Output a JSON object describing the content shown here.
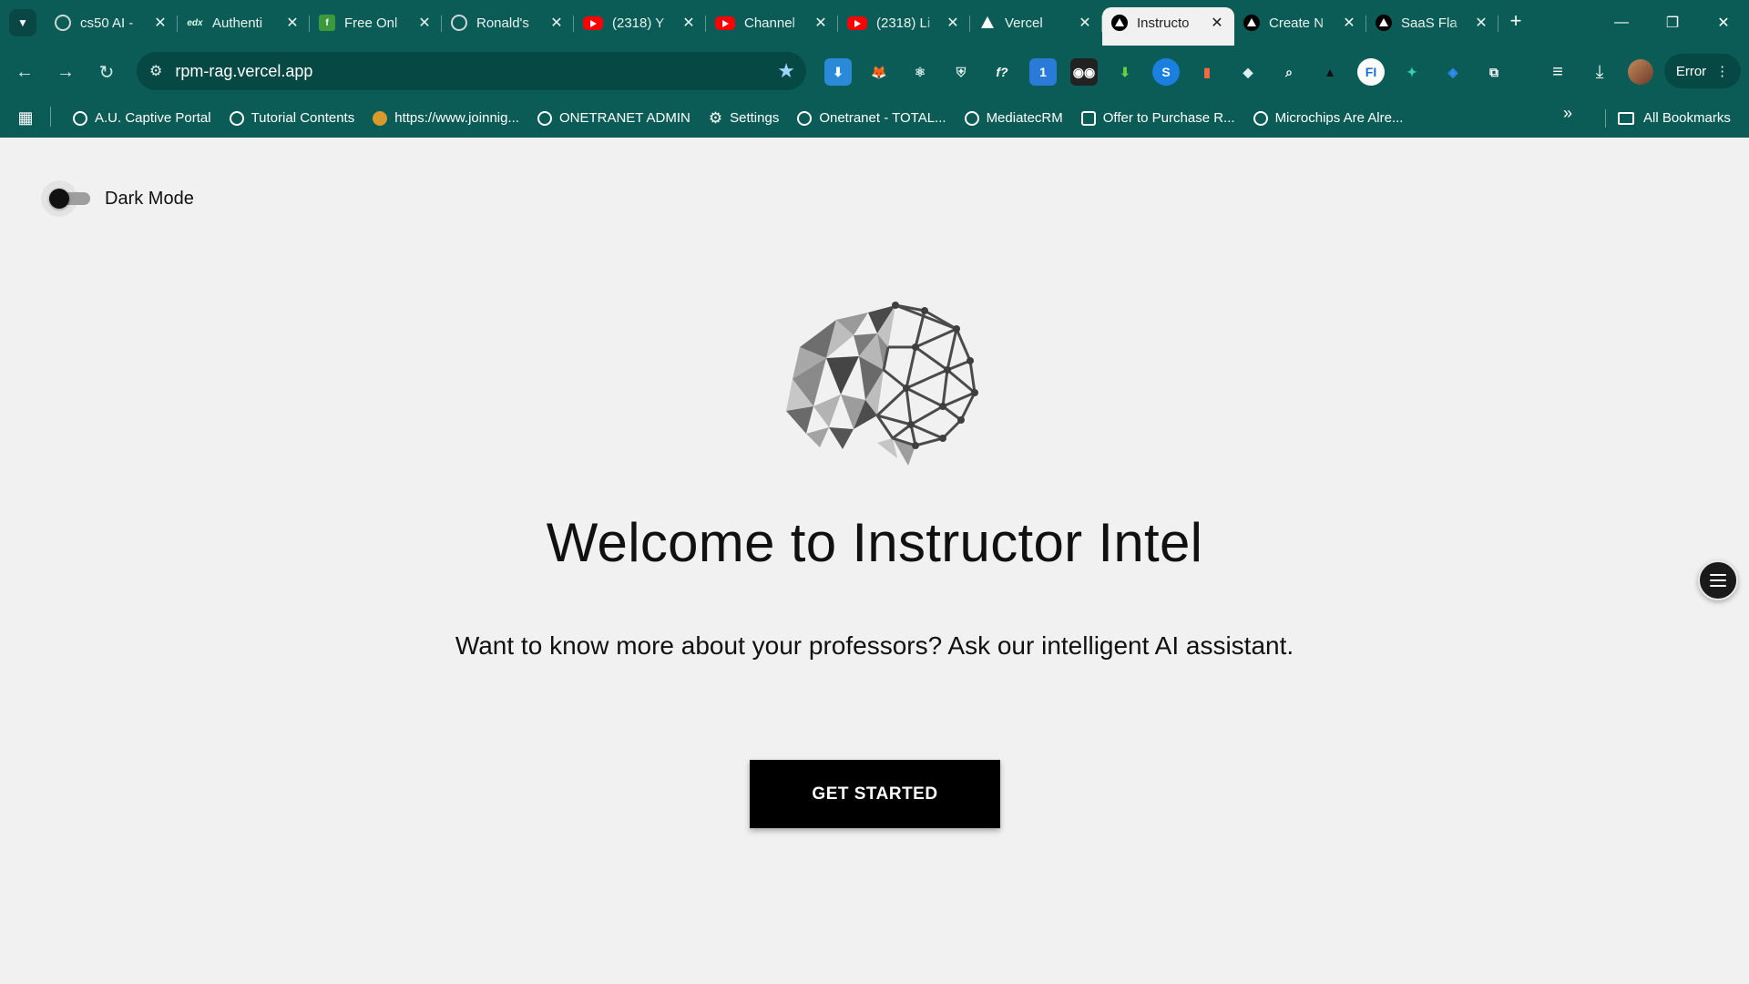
{
  "browser": {
    "tabs": [
      {
        "title": "cs50 AI -",
        "favicon": "openai-icon"
      },
      {
        "title": "Authenti",
        "favicon": "edx-icon"
      },
      {
        "title": "Free Onl",
        "favicon": "green-f-icon"
      },
      {
        "title": "Ronald's",
        "favicon": "globe-icon"
      },
      {
        "title": "(2318) Y",
        "favicon": "youtube-icon"
      },
      {
        "title": "Channel",
        "favicon": "youtube-icon"
      },
      {
        "title": "(2318) Li",
        "favicon": "youtube-icon"
      },
      {
        "title": "Vercel",
        "favicon": "vercel-icon"
      },
      {
        "title": "Instructo",
        "favicon": "vercel-icon",
        "active": true
      },
      {
        "title": "Create N",
        "favicon": "vercel-icon"
      },
      {
        "title": "SaaS Fla",
        "favicon": "vercel-icon"
      }
    ],
    "url": "rpm-rag.vercel.app",
    "profile_status": "Error",
    "bookmarks": [
      "A.U. Captive Portal",
      "Tutorial Contents",
      "https://www.joinnig...",
      "ONETRANET ADMIN",
      "Settings",
      "Onetranet - TOTAL...",
      "MediatecRM",
      "Offer to Purchase R...",
      "Microchips Are Alre..."
    ],
    "all_bookmarks_label": "All Bookmarks",
    "accent_color": "#0b5c56"
  },
  "page": {
    "dark_mode_label": "Dark Mode",
    "dark_mode_on": false,
    "headline": "Welcome to Instructor Intel",
    "subheadline": "Want to know more about your professors? Ask our intelligent AI assistant.",
    "cta_label": "GET STARTED"
  }
}
